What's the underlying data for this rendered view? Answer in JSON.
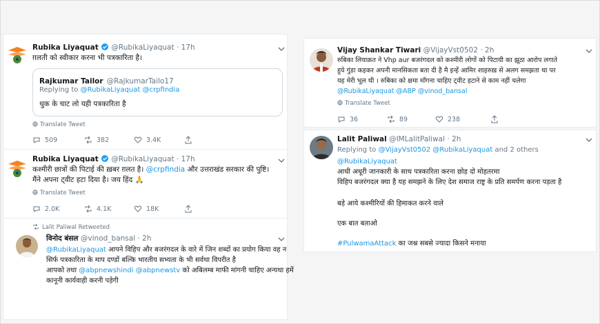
{
  "left": {
    "tweet1": {
      "name": "Rubika Liyaquat",
      "handle": "@RubikaLiyaquat",
      "time": "17h",
      "text": "ग़लती को स्वीकार करना भी पत्रकारिता है।",
      "quote": {
        "name": "Rajkumar Tailor",
        "handle": "@RajkumarTailo17",
        "replying_prefix": "Replying to",
        "replying_to": "@RubikaLiyaquat @crpfindia",
        "text": "थुक के चाट लो यही पत्रकारिता है"
      },
      "translate": "Translate Tweet",
      "replies": "509",
      "retweets": "382",
      "likes": "3.4K"
    },
    "tweet2": {
      "name": "Rubika Liyaquat",
      "handle": "@RubikaLiyaquat",
      "time": "17h",
      "line1_a": "कश्मीरी छात्रों की पिटाई की ख़बर ग़लत है। ",
      "line1_mention": "@crpfindia",
      "line1_b": " और उत्तराखंड सरकार की पुष्टि।",
      "line2": "मैंने अपना ट्वीट हटा दिया है। जय हिंद 🙏",
      "translate": "Translate Tweet",
      "replies": "2.0K",
      "retweets": "4.1K",
      "likes": "18K"
    },
    "tweet3": {
      "retweeted_by": "Lalit Paliwal Retweeted",
      "name": "विनोद बंसल",
      "handle": "@vinod_bansal",
      "time": "2h",
      "line1_mention": "@RubikaLiyaquat",
      "line1_rest": " आपने विहिप और बजरंगदल के वारे में जिन शब्दों का प्रयोग किया वह न",
      "line2": "सिर्फ पत्रकारिता के माप दण्डों बल्कि भारतीय सभ्यता के भी सर्वथा विपरीत है",
      "line3_a": "आपको तथा ",
      "line3_m1": "@abpnewshindi",
      "line3_sp": " ",
      "line3_m2": "@abpnewstv",
      "line3_b": " को अबिलम्ब माफी मांगनी चाहिए अन्यथा हमें",
      "line4": "कानूनी कार्यवाही करनी पड़ेगी"
    }
  },
  "right": {
    "tweet1": {
      "name": "Vijay Shankar Tiwari",
      "handle": "@VijayVst0502",
      "time": "2h",
      "line1": "रुबिका लियाक़त ने Vhp aur बजरंगदल को कश्मीरी लोगों को पिटायी का झूठा आरोप लगाते",
      "line2": "हुये गुंडा कहकर अपनी मानसिकता बता दी है मै इन्हें आमिर शाहरुख़ से अलग समझता था पर",
      "line3": "यह मेरी भूल थी । रुबिका को क्षमा माँगना चाहिए ट्वीट हटाने से काम नहीं चलेगा",
      "m1": "@RubikaLiyaquat",
      "m2": "@ABP",
      "m3": "@vinod_bansal",
      "translate": "Translate Tweet",
      "replies": "36",
      "retweets": "89",
      "likes": "238"
    },
    "tweet2": {
      "name": "Lalit Paliwal",
      "handle": "@IMLalitPaliwal",
      "time": "2h",
      "replying_prefix": "Replying to",
      "replying_m1": "@VijayVst0502",
      "replying_m2": "@RubikaLiyaquat",
      "replying_rest": "and 2 others",
      "mention": "@RubikaLiyaquat",
      "line1": "आधी अधूरी जानकारी के साथ पत्रकारिता करना छोड़ दो मोहतरमा",
      "line2": "विहिप बजरंगदल क्या है यह समझने के लिए देश समाज राष्ट्र के प्रति समर्पण करना पड़ता है",
      "line3": "बड़े आये कश्मीरियों की हिमाकत करने वाले",
      "line4": "एक बात बताओ",
      "hashtag": "#PulwamaAttack",
      "line5_rest": " का जश्न सबसे ज्यादा किसने मनाया"
    }
  },
  "colors": {
    "link": "#1b95e0",
    "muted": "#657786",
    "verified": "#1da1f2"
  }
}
